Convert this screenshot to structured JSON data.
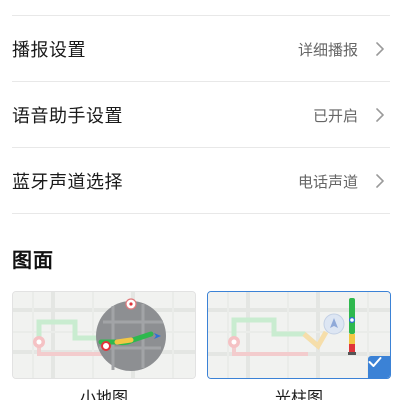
{
  "settings": {
    "rows": [
      {
        "label": "播报设置",
        "value": "详细播报"
      },
      {
        "label": "语音助手设置",
        "value": "已开启"
      },
      {
        "label": "蓝牙声道选择",
        "value": "电话声道"
      }
    ]
  },
  "map_section": {
    "title": "图面",
    "options": [
      {
        "label": "小地图",
        "selected": false
      },
      {
        "label": "光柱图",
        "selected": true
      }
    ]
  },
  "colors": {
    "accent": "#3b82d6",
    "route_green": "#2eb84e",
    "route_yellow": "#f2c744",
    "route_red": "#e0343a",
    "nav_blue": "#2f6fd6"
  },
  "icons": {
    "chevron": "chevron-right-icon",
    "check": "check-icon",
    "destination": "destination-pin-icon",
    "start": "start-point-icon",
    "navigation": "navigation-arrow-icon",
    "compass": "compass-icon"
  }
}
